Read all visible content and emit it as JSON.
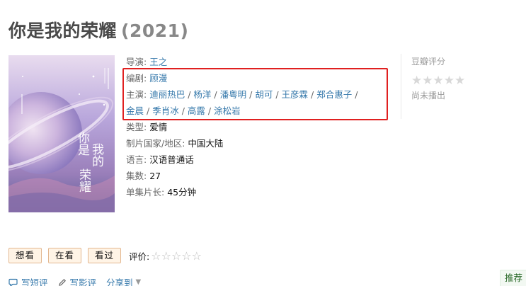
{
  "title": {
    "name": "你是我的荣耀",
    "year": "(2021)"
  },
  "poster": {
    "calligraphy": "你是我的荣耀"
  },
  "info": {
    "director_label": "导演:",
    "director": "王之",
    "writer_label": "编剧:",
    "writer": "顾漫",
    "cast_label": "主演:",
    "cast": [
      "迪丽热巴",
      "杨洋",
      "潘粤明",
      "胡可",
      "王彦霖",
      "郑合惠子",
      "金晨",
      "季肖冰",
      "高露",
      "涂松岩"
    ],
    "separator": "/",
    "genre_label": "类型:",
    "genre": "爱情",
    "region_label": "制片国家/地区:",
    "region": "中国大陆",
    "language_label": "语言:",
    "language": "汉语普通话",
    "episodes_label": "集数:",
    "episodes": "27",
    "runtime_label": "单集片长:",
    "runtime": "45分钟"
  },
  "rating": {
    "label": "豆瓣评分",
    "stars": "★★★★★",
    "status": "尚未播出"
  },
  "actions": {
    "want": "想看",
    "watching": "在看",
    "watched": "看过",
    "rate_label": "评价:",
    "rate_stars": "☆☆☆☆☆"
  },
  "share": {
    "short_review": "写短评",
    "review": "写影评",
    "share_to": "分享到",
    "caret": "▼"
  },
  "recommend": "推荐",
  "colors": {
    "link": "#3377aa",
    "highlight": "#e02020",
    "button_bg": "#fff4e6"
  }
}
